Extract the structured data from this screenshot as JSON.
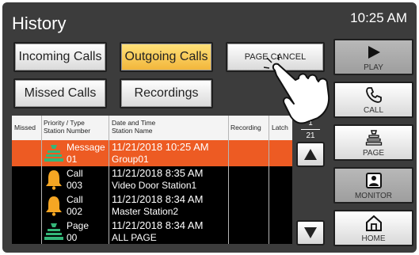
{
  "header": {
    "title": "History",
    "time": "10:25 AM"
  },
  "tabs": {
    "incoming": "Incoming Calls",
    "outgoing": "Outgoing Calls",
    "page_cancel": "PAGE CANCEL",
    "missed": "Missed Calls",
    "recordings": "Recordings"
  },
  "table": {
    "headers": {
      "missed": "Missed",
      "priority_l1": "Priority / Type",
      "priority_l2": "Station Number",
      "datetime_l1": "Date and Time",
      "datetime_l2": "Station Name",
      "recording": "Recording",
      "latch": "Latch"
    },
    "rows": [
      {
        "type": "Message",
        "number": "01",
        "datetime": "11/21/2018 10:25 AM",
        "name": "Group01",
        "icon": "page-speaker-icon",
        "selected": true
      },
      {
        "type": "Call",
        "number": "003",
        "datetime": "11/21/2018  8:35 AM",
        "name": "Video Door Station1",
        "icon": "bell-icon",
        "selected": false
      },
      {
        "type": "Call",
        "number": "002",
        "datetime": "11/21/2018  8:34 AM",
        "name": "Master Station2",
        "icon": "bell-icon",
        "selected": false
      },
      {
        "type": "Page",
        "number": "00",
        "datetime": "11/21/2018  8:34 AM",
        "name": "ALL PAGE",
        "icon": "page-speaker-icon",
        "selected": false
      }
    ]
  },
  "pagination": {
    "current": "1",
    "total": "21"
  },
  "side_menu": {
    "play": "PLAY",
    "call": "CALL",
    "page": "PAGE",
    "monitor": "MONITOR",
    "home": "HOME"
  },
  "colors": {
    "selected_row": "#ed5b23",
    "active_tab": "#f2b53a",
    "bell": "#f5a623",
    "speaker": "#34b678"
  }
}
